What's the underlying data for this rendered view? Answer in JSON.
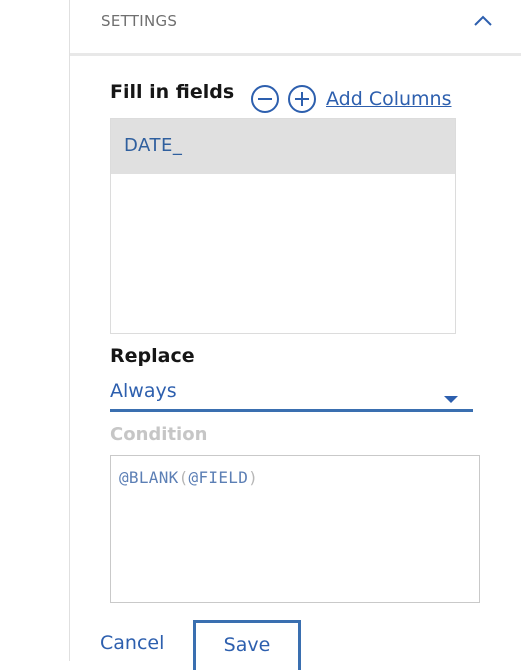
{
  "settings": {
    "title": "SETTINGS"
  },
  "fill": {
    "label": "Fill in fields",
    "add_columns_label": "Add Columns",
    "fields": [
      "DATE_"
    ]
  },
  "replace": {
    "label": "Replace",
    "value": "Always"
  },
  "condition": {
    "label": "Condition",
    "fn": "@BLANK",
    "open_paren": "(",
    "arg": "@FIELD",
    "close_paren": ")"
  },
  "actions": {
    "cancel_label": "Cancel",
    "save_label": "Save"
  },
  "icons": {
    "collapse": "chevron-up-icon",
    "remove": "minus-circle-icon",
    "add": "plus-circle-icon",
    "dropdown": "caret-down-icon"
  },
  "colors": {
    "accent": "#2d5fae",
    "selected_row": "#e0e0e0",
    "disabled_text": "#c6c6c6"
  }
}
